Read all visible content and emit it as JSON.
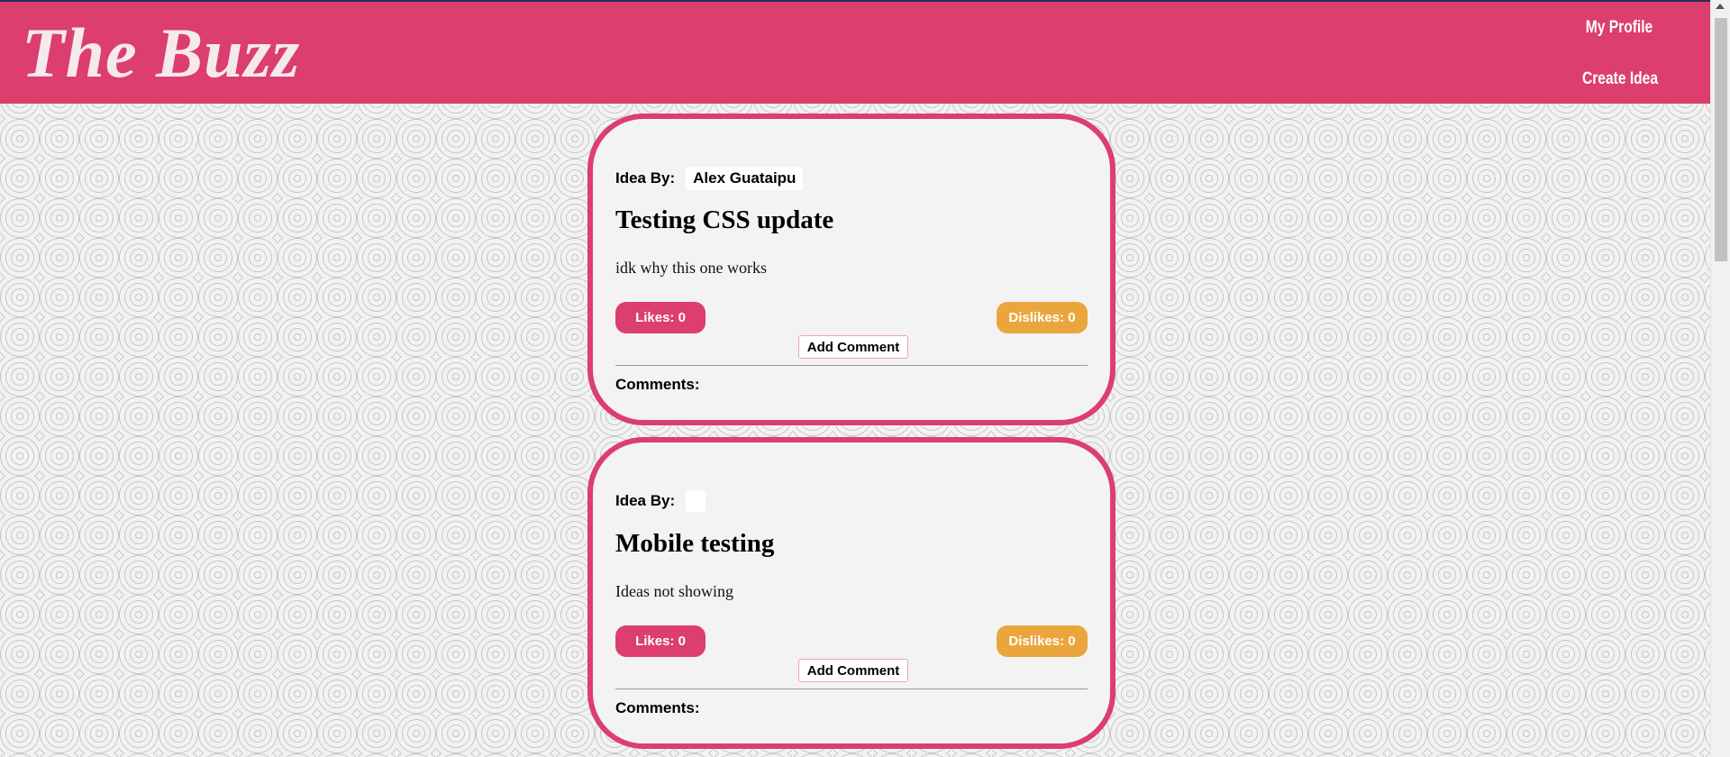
{
  "header": {
    "brand": "The Buzz",
    "nav": {
      "my_profile": "My Profile",
      "create_idea": "Create Idea"
    }
  },
  "colors": {
    "brand_pink": "#dc3e6e",
    "dislike_orange": "#eaa63c",
    "card_background": "#f3f3f3"
  },
  "ideas": [
    {
      "idea_by_label": "Idea By:",
      "author": "Alex Guataipu",
      "title": "Testing CSS update",
      "body": "idk why this one works",
      "likes_label": "Likes: 0",
      "dislikes_label": "Dislikes: 0",
      "add_comment_label": "Add Comment",
      "comments_label": "Comments:"
    },
    {
      "idea_by_label": "Idea By:",
      "author": "",
      "title": "Mobile testing",
      "body": "Ideas not showing",
      "likes_label": "Likes: 0",
      "dislikes_label": "Dislikes: 0",
      "add_comment_label": "Add Comment",
      "comments_label": "Comments:"
    }
  ]
}
